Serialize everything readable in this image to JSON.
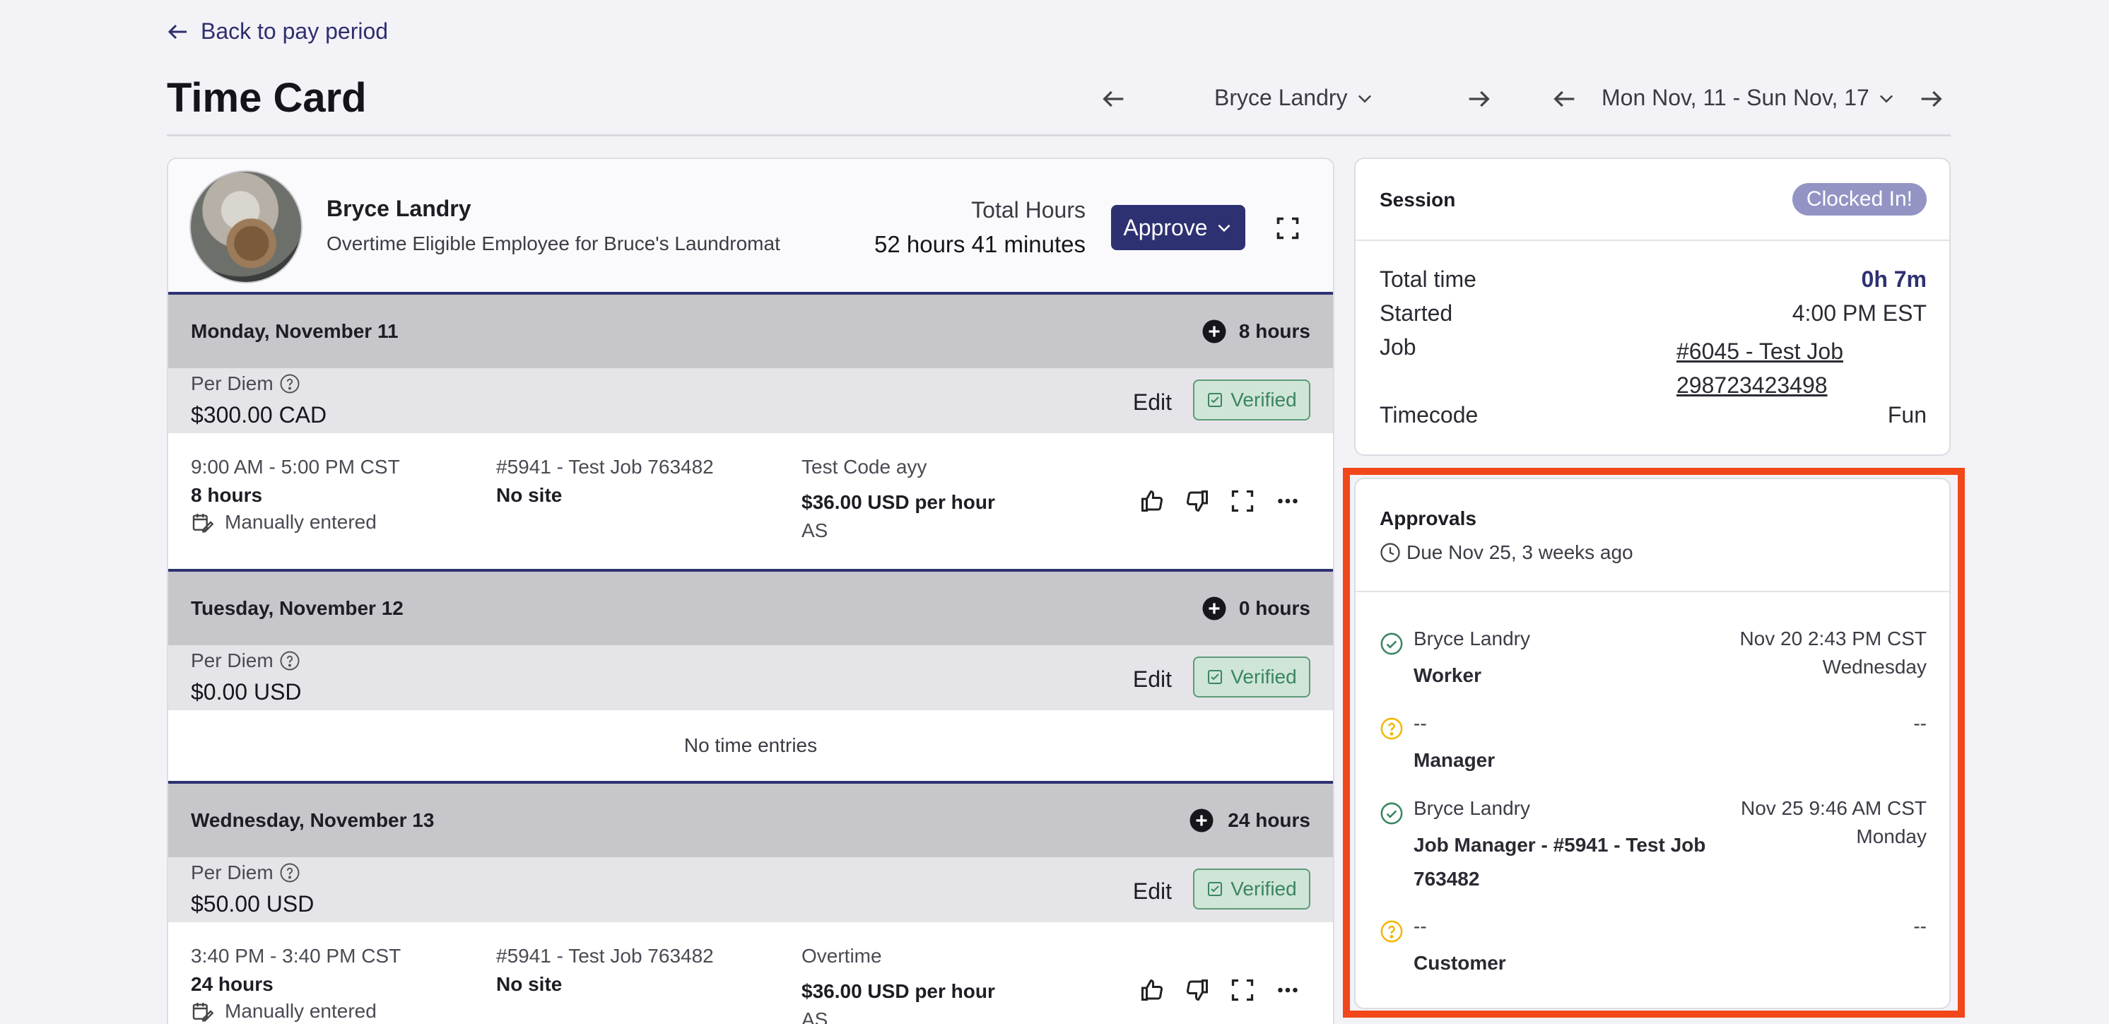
{
  "nav": {
    "back_label": "Back to pay period",
    "page_title": "Time Card",
    "employee_select": "Bryce Landry",
    "period_select": "Mon Nov, 11 - Sun Nov, 17"
  },
  "employee": {
    "name": "Bryce Landry",
    "subtitle": "Overtime Eligible Employee for Bruce's Laundromat",
    "total_hours_label": "Total Hours",
    "total_hours_value": "52 hours 41 minutes",
    "approve_label": "Approve"
  },
  "days": [
    {
      "title": "Monday, November 11",
      "hours": "8 hours",
      "per_diem_label": "Per Diem",
      "per_diem_amount": "$300.00 CAD",
      "edit_label": "Edit",
      "verified_label": "Verified",
      "entry": {
        "time_range": "9:00 AM - 5:00 PM CST",
        "duration": "8 hours",
        "entry_method": "Manually entered",
        "job": "#5941 - Test Job 763482",
        "site": "No site",
        "code": "Test Code ayy",
        "rate": "$36.00 USD per hour",
        "extra": "AS"
      }
    },
    {
      "title": "Tuesday, November 12",
      "hours": "0 hours",
      "per_diem_label": "Per Diem",
      "per_diem_amount": "$0.00 USD",
      "edit_label": "Edit",
      "verified_label": "Verified",
      "empty_label": "No time entries"
    },
    {
      "title": "Wednesday, November 13",
      "hours": "24 hours",
      "per_diem_label": "Per Diem",
      "per_diem_amount": "$50.00 USD",
      "edit_label": "Edit",
      "verified_label": "Verified",
      "entry": {
        "time_range": "3:40 PM - 3:40 PM CST",
        "duration": "24 hours",
        "entry_method": "Manually entered",
        "job": "#5941 - Test Job 763482",
        "site": "No site",
        "code": "Overtime",
        "rate": "$36.00 USD per hour",
        "extra": "AS"
      }
    }
  ],
  "session": {
    "title": "Session",
    "status_badge": "Clocked In!",
    "total_time_label": "Total time",
    "total_time_value": "0h 7m",
    "started_label": "Started",
    "started_value": "4:00 PM EST",
    "job_label": "Job",
    "job_value_line1": "#6045 - Test Job",
    "job_value_line2": "298723423498",
    "timecode_label": "Timecode",
    "timecode_value": "Fun"
  },
  "approvals": {
    "title": "Approvals",
    "due": "Due Nov 25, 3 weeks ago",
    "items": [
      {
        "name": "Bryce Landry",
        "role": "Worker",
        "date": "Nov 20 2:43 PM CST",
        "day": "Wednesday",
        "status": "approved"
      },
      {
        "name": "--",
        "role": "Manager",
        "date": "--",
        "day": "",
        "status": "pending"
      },
      {
        "name": "Bryce Landry",
        "role": "Job Manager - #5941 - Test Job 763482",
        "date": "Nov 25 9:46 AM CST",
        "day": "Monday",
        "status": "approved"
      },
      {
        "name": "--",
        "role": "Customer",
        "date": "--",
        "day": "",
        "status": "pending"
      }
    ]
  },
  "colors": {
    "accent": "#2e3171",
    "verified": "#3a8660",
    "pending": "#f2b705",
    "highlight": "#f2471a"
  }
}
